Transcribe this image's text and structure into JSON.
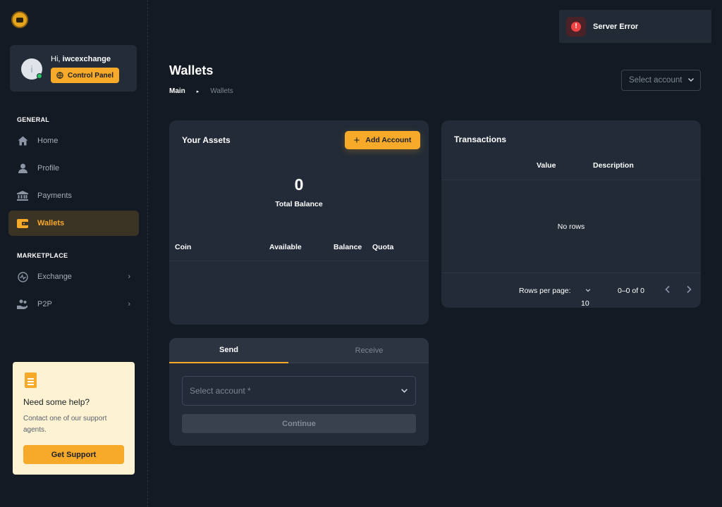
{
  "sidebar": {
    "user": {
      "greeting_prefix": "Hi,",
      "username": "iwcexchange",
      "avatar_initial": "i",
      "control_panel_label": "Control Panel"
    },
    "general_label": "GENERAL",
    "marketplace_label": "MARKETPLACE",
    "items": [
      {
        "label": "Home",
        "icon": "home-icon"
      },
      {
        "label": "Profile",
        "icon": "user-icon"
      },
      {
        "label": "Payments",
        "icon": "bank-icon"
      },
      {
        "label": "Wallets",
        "icon": "wallet-icon",
        "active": true
      },
      {
        "label": "Exchange",
        "icon": "exchange-icon"
      },
      {
        "label": "P2P",
        "icon": "p2p-icon"
      }
    ],
    "help": {
      "title": "Need some help?",
      "text": "Contact one of our support agents.",
      "button_label": "Get Support"
    }
  },
  "toast": {
    "message": "Server Error",
    "icon_glyph": "!"
  },
  "header": {
    "title": "Wallets",
    "breadcrumb": {
      "root": "Main",
      "separator": "▸",
      "current": "Wallets"
    },
    "account_select_placeholder": "Select account"
  },
  "assets": {
    "title": "Your Assets",
    "add_button_label": "Add Account",
    "total_balance_value": "0",
    "total_balance_label": "Total Balance",
    "columns": [
      "Coin",
      "Available",
      "Balance",
      "Quota"
    ]
  },
  "transactions": {
    "title": "Transactions",
    "columns": [
      "Value",
      "Description"
    ],
    "empty_text": "No rows",
    "rows_per_page_label": "Rows per page:",
    "rows_per_page_value": "10",
    "range_text": "0–0 of 0"
  },
  "send_receive": {
    "tabs": [
      "Send",
      "Receive"
    ],
    "select_placeholder": "Select account *",
    "continue_label": "Continue"
  },
  "colors": {
    "accent": "#f7a92a",
    "background": "#141a24",
    "card": "#222b37",
    "error": "#ef4444",
    "online": "#22c55e"
  }
}
